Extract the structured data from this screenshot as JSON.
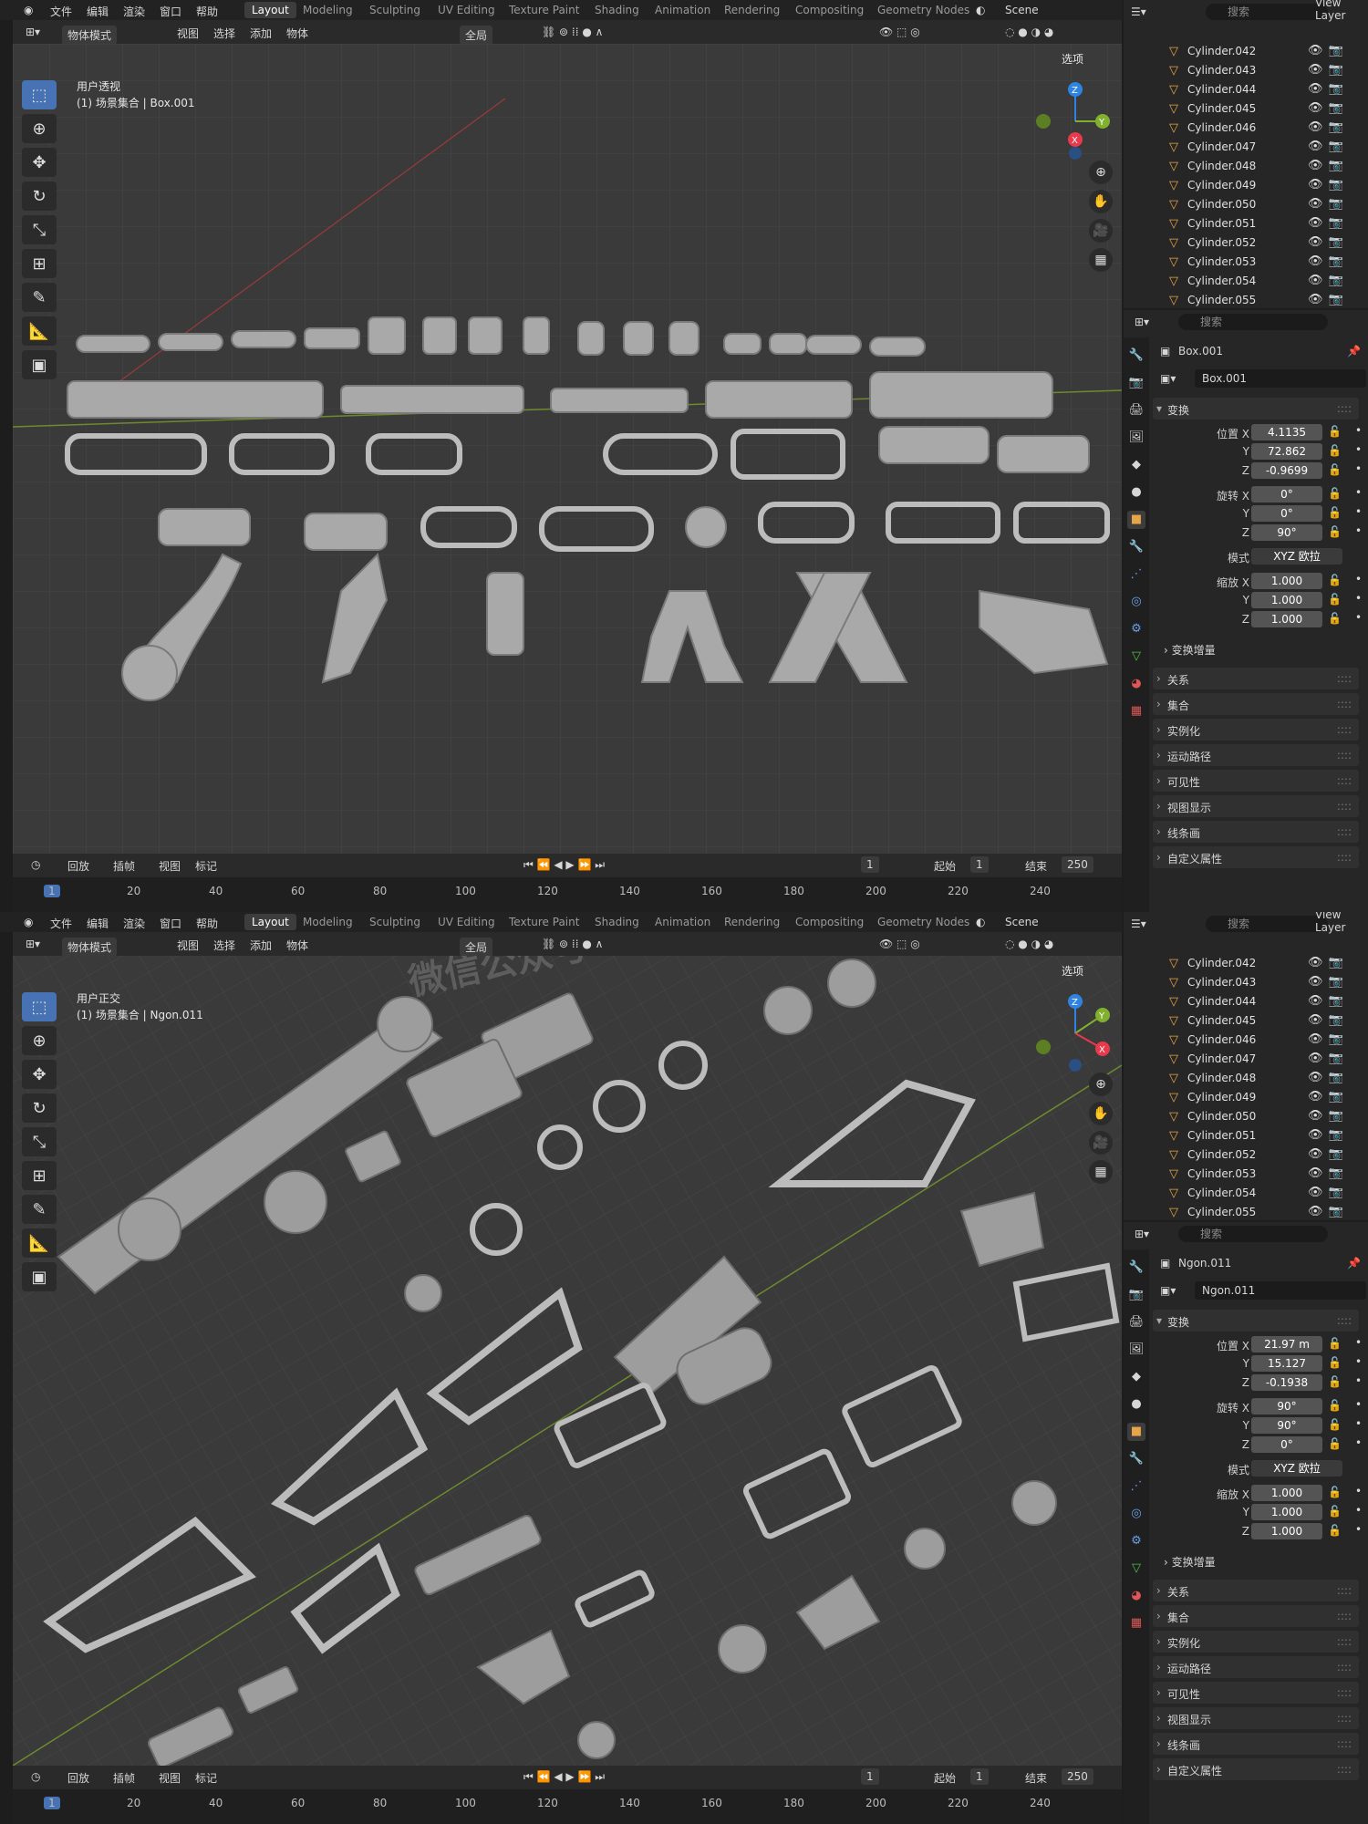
{
  "menubar": {
    "logo": "blender-logo",
    "items": [
      "文件",
      "编辑",
      "渲染",
      "窗口",
      "帮助"
    ],
    "workspaces": [
      "Layout",
      "Modeling",
      "Sculpting",
      "UV Editing",
      "Texture Paint",
      "Shading",
      "Animation",
      "Rendering",
      "Compositing",
      "Geometry Nodes"
    ],
    "active_workspace": "Layout",
    "scene": "Scene",
    "view_layer": "View Layer"
  },
  "toolbar": {
    "mode": "物体模式",
    "menus": [
      "视图",
      "选择",
      "添加",
      "物体"
    ],
    "transform_orientation": "全局",
    "options": "选项"
  },
  "viewports": [
    {
      "view_name": "用户透视",
      "collection_info": "(1) 场景集合 | Box.001"
    },
    {
      "view_name": "用户正交",
      "collection_info": "(1) 场景集合 | Ngon.011"
    }
  ],
  "gizmo": {
    "x": "X",
    "y": "Y",
    "z": "Z",
    "colors": {
      "x": "#e8394d",
      "y": "#80b02e",
      "z": "#2f84e3"
    }
  },
  "outliner": {
    "search_placeholder": "搜索",
    "items": [
      "Cylinder.042",
      "Cylinder.043",
      "Cylinder.044",
      "Cylinder.045",
      "Cylinder.046",
      "Cylinder.047",
      "Cylinder.048",
      "Cylinder.049",
      "Cylinder.050",
      "Cylinder.051",
      "Cylinder.052",
      "Cylinder.053",
      "Cylinder.054",
      "Cylinder.055"
    ]
  },
  "properties": [
    {
      "search_placeholder": "搜索",
      "object_name": "Box.001",
      "transform_label": "变换",
      "location": {
        "label": "位置 X",
        "x": "4.1135",
        "y": "72.862",
        "z": "-0.9699"
      },
      "rotation": {
        "label": "旋转 X",
        "x": "0°",
        "y": "0°",
        "z": "90°"
      },
      "mode": {
        "label": "模式",
        "value": "XYZ 欧拉"
      },
      "scale": {
        "label": "缩放 X",
        "x": "1.000",
        "y": "1.000",
        "z": "1.000"
      },
      "y_label": "Y",
      "z_label": "Z",
      "delta": "变换增量",
      "panels": [
        "关系",
        "集合",
        "实例化",
        "运动路径",
        "可见性",
        "视图显示",
        "线条画",
        "自定义属性"
      ]
    },
    {
      "search_placeholder": "搜索",
      "object_name": "Ngon.011",
      "transform_label": "变换",
      "location": {
        "label": "位置 X",
        "x": "21.97 m",
        "y": "15.127",
        "z": "-0.1938"
      },
      "rotation": {
        "label": "旋转 X",
        "x": "90°",
        "y": "90°",
        "z": "0°"
      },
      "mode": {
        "label": "模式",
        "value": "XYZ 欧拉"
      },
      "scale": {
        "label": "缩放 X",
        "x": "1.000",
        "y": "1.000",
        "z": "1.000"
      },
      "y_label": "Y",
      "z_label": "Z",
      "delta": "变换增量",
      "panels": [
        "关系",
        "集合",
        "实例化",
        "运动路径",
        "可见性",
        "视图显示",
        "线条画",
        "自定义属性"
      ]
    }
  ],
  "timeline": {
    "menus": [
      "回放",
      "插帧",
      "视图",
      "标记"
    ],
    "current_frame": "1",
    "start_label": "起始",
    "start": "1",
    "end_label": "结束",
    "end": "250",
    "ruler": [
      "1",
      "20",
      "40",
      "60",
      "80",
      "100",
      "120",
      "140",
      "160",
      "180",
      "200",
      "220",
      "240"
    ]
  },
  "watermark": "微信公众号：资源设"
}
